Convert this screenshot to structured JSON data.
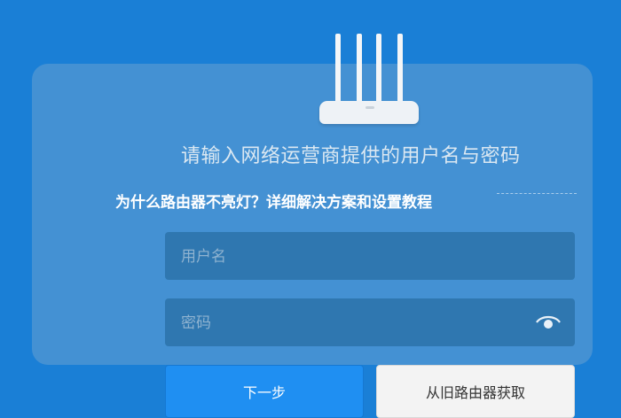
{
  "overlay_title": "为什么路由器不亮灯？详细解决方案和设置教程",
  "instruction": "请输入网络运营商提供的用户名与密码",
  "form": {
    "username_placeholder": "用户名",
    "password_placeholder": "密码"
  },
  "buttons": {
    "next": "下一步",
    "from_old_router": "从旧路由器获取"
  },
  "icons": {
    "router": "router-icon",
    "password_toggle": "eye-icon"
  },
  "colors": {
    "background": "#1a7fd6",
    "primary_button": "#1f8ff2",
    "secondary_button": "#f3f3f3"
  }
}
